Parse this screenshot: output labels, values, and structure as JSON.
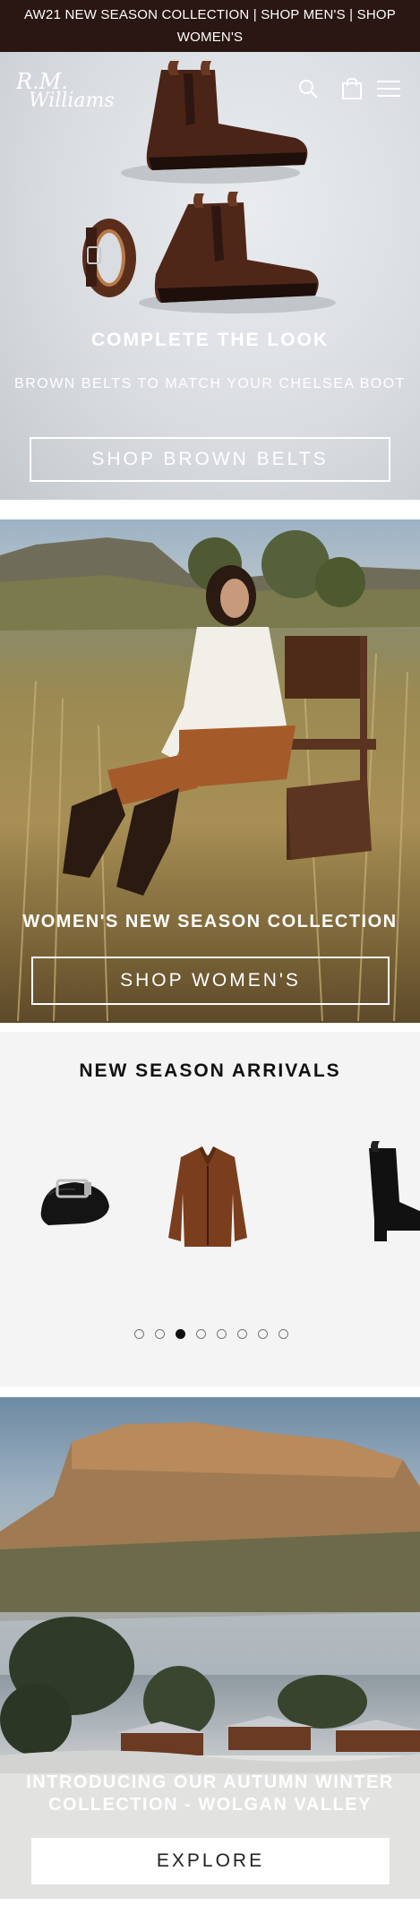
{
  "announcement": {
    "text": "AW21 NEW SEASON COLLECTION | SHOP MEN'S | SHOP WOMEN'S"
  },
  "header": {
    "logo_line1": "R.M.",
    "logo_line2": "Williams",
    "icons": [
      "search-icon",
      "bag-icon",
      "menu-icon"
    ]
  },
  "hero1": {
    "title": "COMPLETE THE LOOK",
    "subtitle": "BROWN BELTS TO MATCH YOUR CHELSEA BOOT",
    "button": "SHOP BROWN BELTS"
  },
  "hero2": {
    "title": "WOMEN'S NEW SEASON COLLECTION",
    "button": "SHOP WOMEN'S"
  },
  "arrivals": {
    "title": "NEW SEASON ARRIVALS",
    "products": [
      "belt",
      "leather-jacket",
      "heeled-boot"
    ],
    "dots_total": 8,
    "active_dot": 3
  },
  "hero3": {
    "title": "INTRODUCING OUR AUTUMN WINTER COLLECTION - WOLGAN VALLEY",
    "button": "EXPLORE"
  },
  "colors": {
    "announcement_bg": "#2a1612",
    "leather_brown": "#4a2417",
    "arrivals_bg": "#f4f4f4"
  }
}
